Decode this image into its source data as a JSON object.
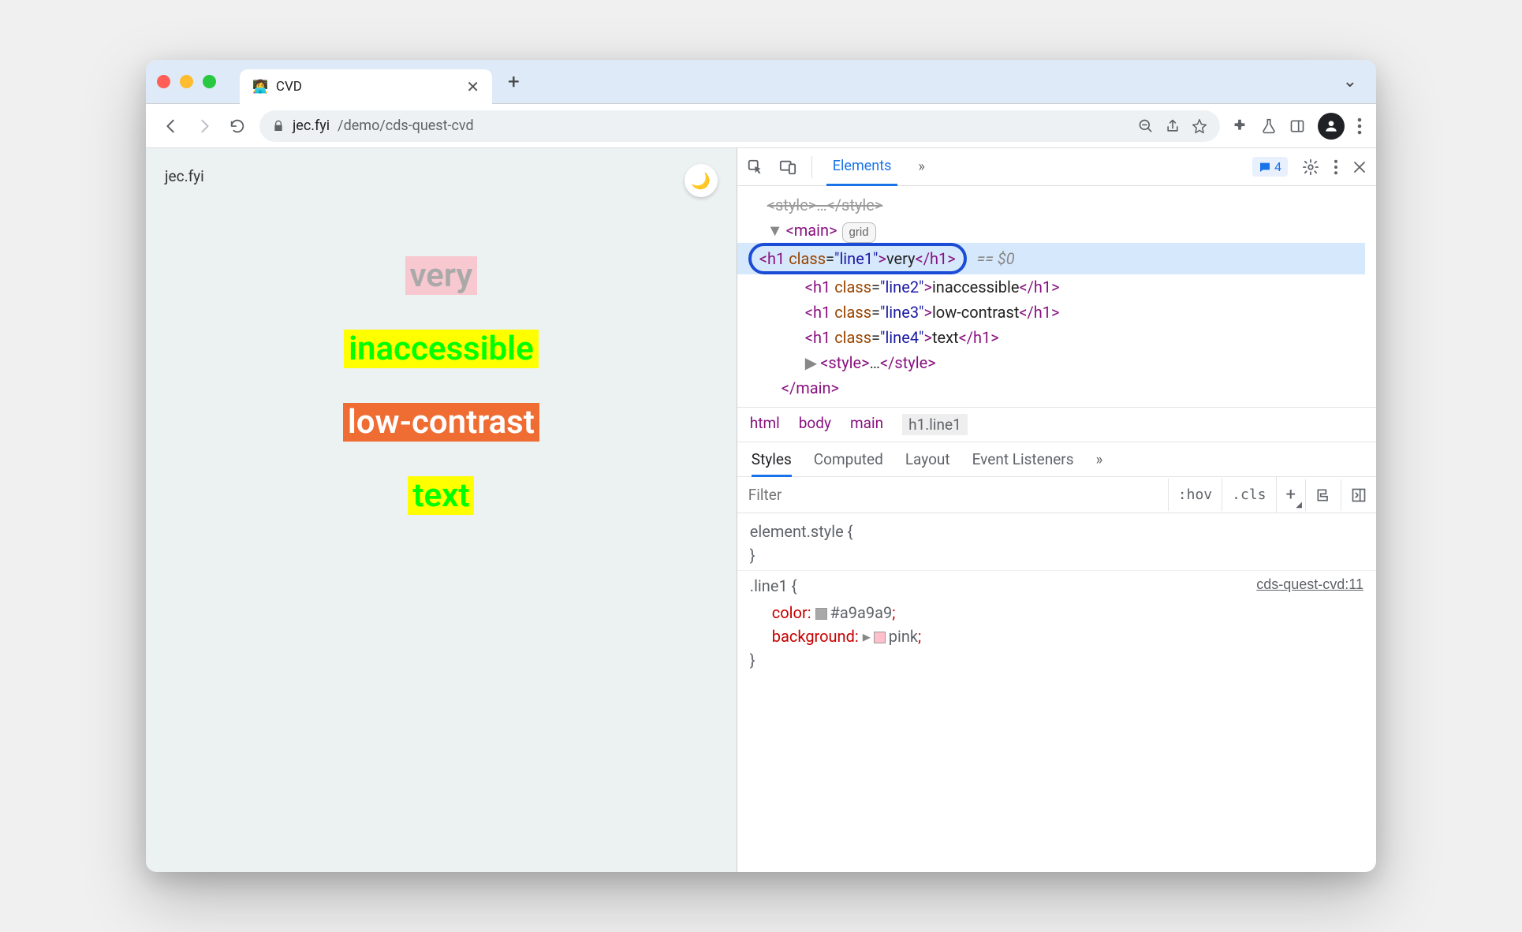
{
  "chrome": {
    "traffic": {
      "close": "#ff5f57",
      "min": "#febc2e",
      "max": "#28c840"
    },
    "tab": {
      "title": "CVD",
      "favicon_emoji": "👩‍💻"
    },
    "chevron_label": "v",
    "back_icon": "back-icon",
    "forward_icon": "forward-icon",
    "reload_icon": "reload-icon",
    "url": {
      "domain": "jec.fyi",
      "path": "/demo/cds-quest-cvd"
    }
  },
  "page": {
    "site_label": "jec.fyi",
    "theme_icon": "🌙",
    "lines": [
      {
        "text": "very",
        "bg": "#f8c8d0",
        "fg": "#a9a9a9"
      },
      {
        "text": "inaccessible",
        "bg": "#ffff00",
        "fg": "#00ff00"
      },
      {
        "text": "low-contrast",
        "bg": "#ef6c33",
        "fg": "#ffffff"
      },
      {
        "text": "text",
        "bg": "#ffff00",
        "fg": "#00ff00"
      }
    ]
  },
  "devtools": {
    "tabs": {
      "elements": "Elements",
      "more": "»"
    },
    "issues_count": "4",
    "dom": {
      "main_open": "<main>",
      "grid_badge": "grid",
      "h1_1": {
        "open": "<h1 class=\"line1\">",
        "text": "very",
        "close": "</h1>",
        "suffix": "== $0"
      },
      "h1_2": {
        "open": "<h1 class=\"line2\">",
        "text": "inaccessible",
        "close": "</h1>"
      },
      "h1_3": {
        "open": "<h1 class=\"line3\">",
        "text": "low-contrast",
        "close": "</h1>"
      },
      "h1_4": {
        "open": "<h1 class=\"line4\">",
        "text": "text",
        "close": "</h1>"
      },
      "style_open": "<style>",
      "style_ellipsis": "…",
      "style_close": "</style>",
      "main_close": "</main>"
    },
    "breadcrumb": [
      "html",
      "body",
      "main",
      "h1.line1"
    ],
    "styles_tabs": {
      "styles": "Styles",
      "computed": "Computed",
      "layout": "Layout",
      "event": "Event Listeners",
      "more": "»"
    },
    "filter_placeholder": "Filter",
    "filter_buttons": {
      "hov": ":hov",
      "cls": ".cls",
      "plus": "+"
    },
    "css": {
      "element_style": "element.style {",
      "element_style_close": "}",
      "rule_selector": ".line1 {",
      "rule_source": "cds-quest-cvd:11",
      "prop_color_name": "color",
      "prop_color_val": "#a9a9a9",
      "prop_color_swatch": "#a9a9a9",
      "prop_bg_name": "background",
      "prop_bg_val": "pink",
      "prop_bg_swatch": "#ffc0cb",
      "rule_close": "}"
    }
  }
}
